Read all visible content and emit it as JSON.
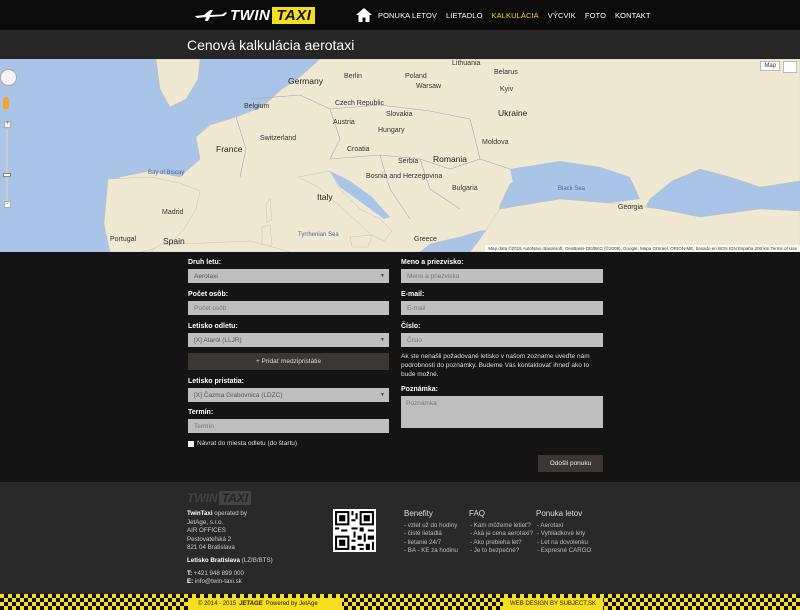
{
  "header": {
    "logo_twin": "TWIN",
    "logo_taxi": "TAXI",
    "nav": [
      {
        "label": "PONUKA LETOV"
      },
      {
        "label": "LIETADLO"
      },
      {
        "label": "KALKULÁCIA"
      },
      {
        "label": "VÝCVIK"
      },
      {
        "label": "FOTO"
      },
      {
        "label": "KONTAKT"
      }
    ],
    "active_color": "#f4de1d"
  },
  "page": {
    "title": "Cenová kalkulácia aerotaxi"
  },
  "map": {
    "type_button": "Map",
    "footer": "Map data ©2015 AutoNavi, Basarsoft, GeoBasis-DE/BKG (©2009), Google, Mapa GISrael, ORION-ME, basado en BCN IGN España   200 km   Terms of Use",
    "labels": {
      "germany": "Germany",
      "france": "France",
      "ukraine": "Ukraine",
      "romania": "Romania",
      "italy": "Italy",
      "spain": "Spain",
      "portugal": "Portugal",
      "poland": "Poland",
      "belarus": "Belarus",
      "czech": "Czech Republic",
      "austria": "Austria",
      "hungary": "Hungary",
      "serbia": "Serbia",
      "bulgaria": "Bulgaria",
      "greece": "Greece",
      "black_sea": "Black Sea",
      "georgia": "Georgia",
      "lithuania": "Lithuania",
      "switzerland": "Switzerland",
      "croatia": "Croatia",
      "bosnia": "Bosnia and Herzegovina",
      "belgium": "Belgium",
      "madrid": "Madrid",
      "bay_of_biscay": "Bay of Biscay",
      "warsaw": "Warsaw",
      "berlin": "Berlin",
      "kyiv": "Kyiv",
      "moldova": "Moldova",
      "tyrrhenian": "Tyrrhenian Sea",
      "slovakia": "Slovakia"
    }
  },
  "form": {
    "druh_label": "Druh letu:",
    "druh_value": "Aerotaxi",
    "pocet_label": "Počet osôb:",
    "pocet_placeholder": "Počet osôb",
    "odlet_label": "Letisko odletu:",
    "odlet_value": "[X] Ataról (LLJR)",
    "add_stop": "+ Pridať medzipristátie",
    "pristatie_label": "Letisko pristatia:",
    "pristatie_value": "[X] Čazma Grabovnica (LDZC)",
    "termin_label": "Termín:",
    "termin_placeholder": "Termín",
    "navrat_label": "Návrat do miesta odletu (do štartu)",
    "meno_label": "Meno a priezvisko:",
    "meno_placeholder": "Meno a priezvisko",
    "email_label": "E-mail:",
    "email_placeholder": "E-mail",
    "cislo_label": "Číslo:",
    "cislo_placeholder": "Číslo",
    "note": "Ak ste nenašli požadované letisko v našom zozname uveďte nám podrobnosti do poznámky. Budeme Vás kontaktovať ihneď ako to bude možné.",
    "poznamka_label": "Poznámka:",
    "poznamka_placeholder": "Poznámka",
    "submit": "Odošli ponuku"
  },
  "footer": {
    "logo_twin": "TWIN",
    "logo_taxi": "TAXI",
    "company_bold": "TwinTaxi",
    "company_rest": " operated by",
    "lines": [
      "JetAge, s.r.o.",
      "AIR OFFICES",
      "Pestovateľská 2",
      "821 04 Bratislava"
    ],
    "airport_bold": "Letisko Bratislava",
    "airport_rest": " (LZIB/BTS)",
    "phone_label": "T:",
    "phone": " +421 948 899 000",
    "email_label": "E:",
    "email": " info@twin-taxi.sk",
    "columns": [
      {
        "title": "Benefity",
        "links": [
          "- vzlet už do hodiny",
          "- čisté lietadlá",
          "- lietanie 24/7",
          "- BA - KE za hodinu"
        ]
      },
      {
        "title": "FAQ",
        "links": [
          "- Kam môžeme letieť?",
          "- Aká je cena aerotaxi?",
          "- Ako prebieha let?",
          "- Je to bezpečné?"
        ]
      },
      {
        "title": "Ponuka letov",
        "links": [
          "- Aerotaxi",
          "- Vyhliadkové lety",
          "- Let na dovolenku",
          "- Expresné CARGO"
        ]
      }
    ],
    "copyright_pre": "© 2014 - 2015",
    "copyright_brand": "JETAGE",
    "copyright_post": "Powered by JetAge",
    "design": "WEB DESIGN BY SUBJECT.SK"
  }
}
